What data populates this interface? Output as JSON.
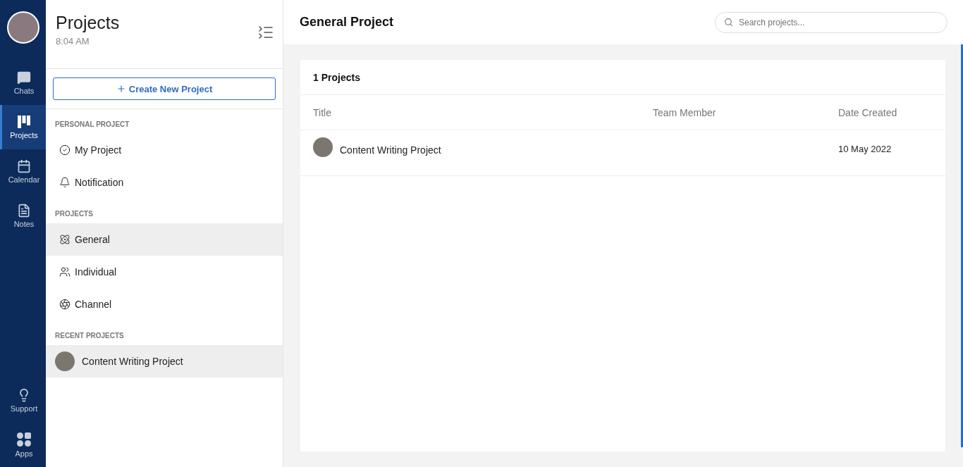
{
  "rail": {
    "top": [
      {
        "label": "Chats",
        "kind": "chats",
        "selected": false
      },
      {
        "label": "Projects",
        "kind": "projects",
        "selected": true
      },
      {
        "label": "Calendar",
        "kind": "calendar",
        "selected": false
      },
      {
        "label": "Notes",
        "kind": "notes",
        "selected": false
      }
    ],
    "bottom": [
      {
        "label": "Support",
        "kind": "support",
        "selected": false
      },
      {
        "label": "Apps",
        "kind": "apps",
        "selected": false
      }
    ]
  },
  "panel": {
    "title": "Projects",
    "time": "8:04 AM",
    "create_button": "Create New Project",
    "sections": [
      {
        "heading": "PERSONAL PROJECT",
        "items": [
          {
            "label": "My Project",
            "kind": "check",
            "selected": false
          },
          {
            "label": "Notification",
            "kind": "bell",
            "selected": false
          }
        ]
      },
      {
        "heading": "PROJECTS",
        "items": [
          {
            "label": "General",
            "kind": "network",
            "selected": true
          },
          {
            "label": "Individual",
            "kind": "people",
            "selected": false
          },
          {
            "label": "Channel",
            "kind": "channel",
            "selected": false
          }
        ]
      },
      {
        "heading": "RECENT PROJECTS",
        "items": [
          {
            "label": "Content Writing Project",
            "kind": "thumb",
            "selected": true
          }
        ]
      }
    ]
  },
  "main": {
    "title": "General Project",
    "search": {
      "placeholder": "Search projects..."
    },
    "count": "1 Projects",
    "table": {
      "columns": [
        "Title",
        "Team Member",
        "Date Created"
      ],
      "rows": [
        {
          "title": "Content Writing Project",
          "date": "10 May 2022"
        }
      ]
    }
  }
}
